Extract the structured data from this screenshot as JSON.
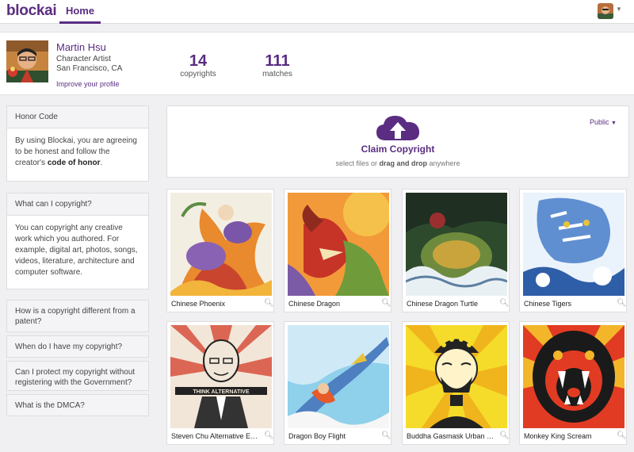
{
  "nav": {
    "logo": "blockai",
    "tabs": [
      {
        "label": "Home",
        "active": true
      }
    ],
    "brand_color": "#5a2d82"
  },
  "profile": {
    "name": "Martin Hsu",
    "role": "Character Artist",
    "location": "San Francisco, CA",
    "improve_link": "Improve your profile",
    "stats": [
      {
        "value": "14",
        "label": "copyrights"
      },
      {
        "value": "111",
        "label": "matches"
      }
    ]
  },
  "sidebar": {
    "honor": {
      "title": "Honor Code",
      "body_prefix": "By using Blockai, you are agreeing to be honest and follow the creator's",
      "body_bold": "code of honor",
      "body_suffix": "."
    },
    "what": {
      "title": "What can I copyright?",
      "body": "You can copyright any creative work which you authored. For example, digital art, photos, songs, videos, literature, architecture and computer software."
    },
    "faq": [
      "How is a copyright different from a patent?",
      "When do I have my copyright?",
      "Can I protect my copyright without registering with the Government?",
      "What is the DMCA?"
    ]
  },
  "upload": {
    "claim_label": "Claim Copyright",
    "hint_prefix": "select files or",
    "hint_bold": "drag and drop",
    "hint_suffix": "anywhere",
    "privacy": "Public",
    "icon": "cloud-upload-icon"
  },
  "works": [
    {
      "title": "Chinese Phoenix"
    },
    {
      "title": "Chinese Dragon"
    },
    {
      "title": "Chinese Dragon Turtle"
    },
    {
      "title": "Chinese Tigers"
    },
    {
      "title": "Steven Chu Alternative Energy"
    },
    {
      "title": "Dragon Boy Flight"
    },
    {
      "title": "Buddha Gasmask Urban Cleaner"
    },
    {
      "title": "Monkey King Scream"
    }
  ],
  "art_captions": {
    "steven_chu_banner": "THINK ALTERNATIVE"
  }
}
